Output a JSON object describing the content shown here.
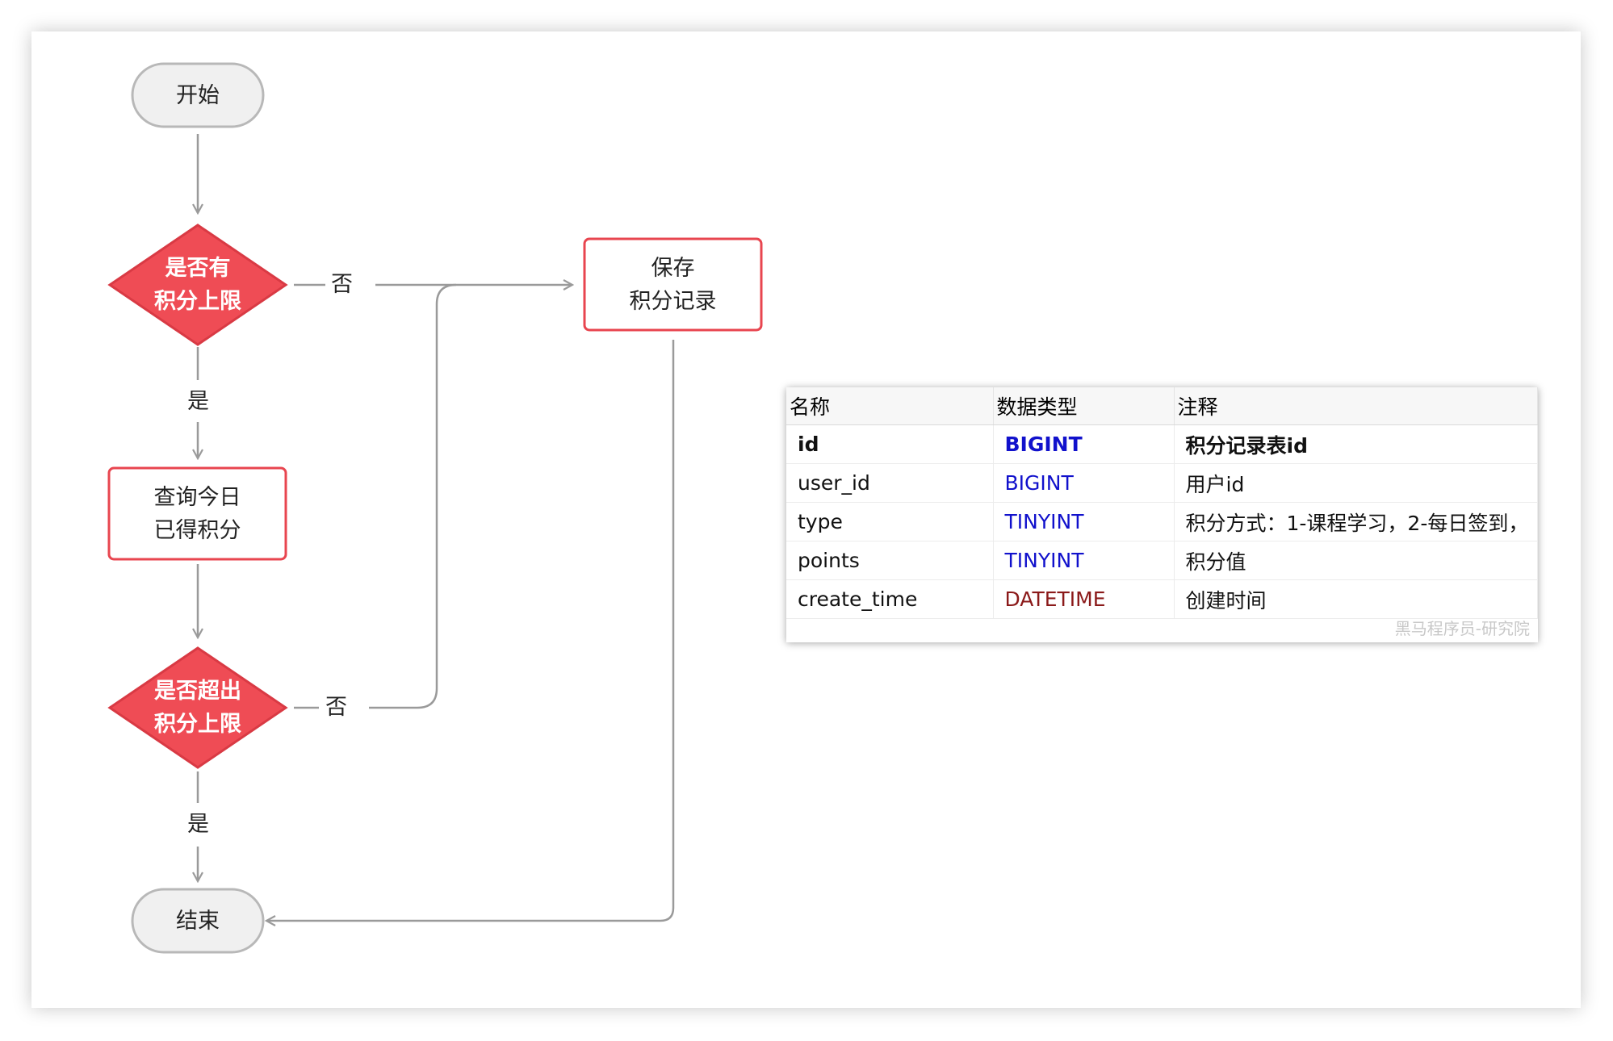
{
  "flowchart": {
    "start": "开始",
    "decision1": [
      "是否有",
      "积分上限"
    ],
    "query": [
      "查询今日",
      "已得积分"
    ],
    "decision2": [
      "是否超出",
      "积分上限"
    ],
    "save": [
      "保存",
      "积分记录"
    ],
    "end": "结束",
    "label_no_1": "否",
    "label_yes_1": "是",
    "label_no_2": "否",
    "label_yes_2": "是"
  },
  "colors": {
    "decision_fill": "#ef4c55",
    "decision_stroke": "#d93a44",
    "process_stroke": "#e8454f",
    "terminal_fill": "#f0f0f0",
    "terminal_stroke": "#b8b8b8",
    "connector": "#9a9a9a"
  },
  "table": {
    "headers": [
      "名称",
      "数据类型",
      "注释"
    ],
    "rows": [
      {
        "name": "id",
        "type": "BIGINT",
        "comment": "积分记录表id",
        "type_color": "#1111cc",
        "primary": true
      },
      {
        "name": "user_id",
        "type": "BIGINT",
        "comment": "用户id",
        "type_color": "#1111cc",
        "primary": false
      },
      {
        "name": "type",
        "type": "TINYINT",
        "comment": "积分方式：1-课程学习，2-每日签到，",
        "type_color": "#1111cc",
        "primary": false
      },
      {
        "name": "points",
        "type": "TINYINT",
        "comment": "积分值",
        "type_color": "#1111cc",
        "primary": false
      },
      {
        "name": "create_time",
        "type": "DATETIME",
        "comment": "创建时间",
        "type_color": "#8b1a1a",
        "primary": false
      }
    ],
    "watermark": "黑马程序员-研究院"
  }
}
